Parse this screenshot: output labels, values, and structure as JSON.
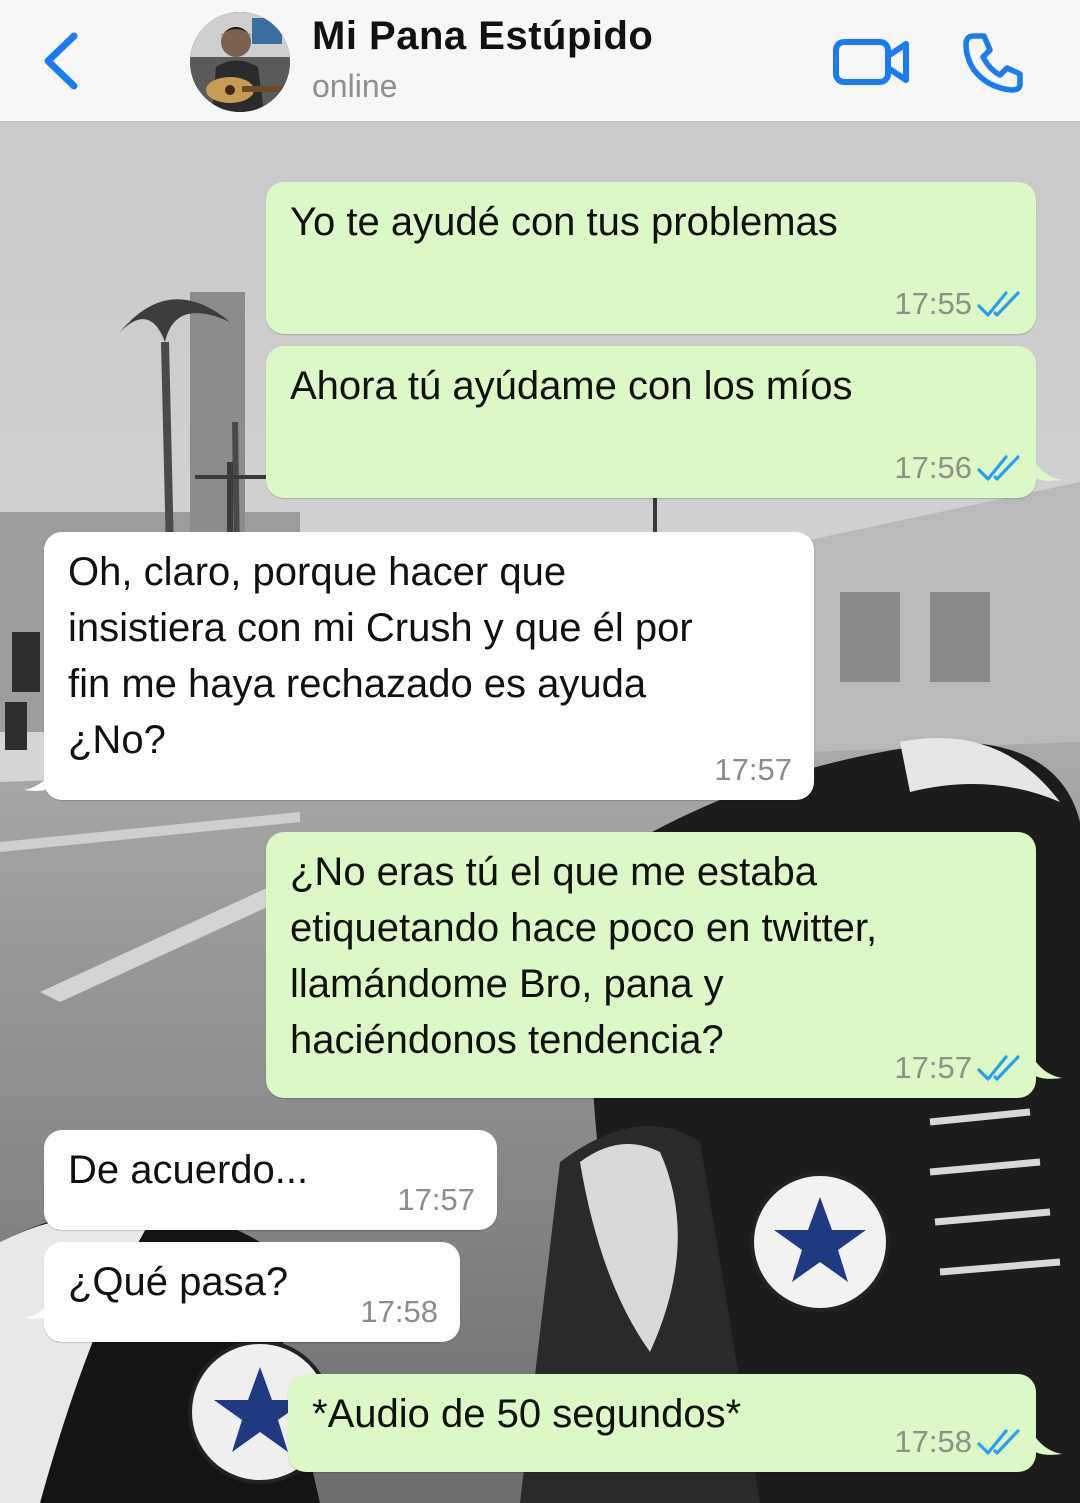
{
  "header": {
    "contact_name": "Mi Pana Estúpido",
    "status": "online",
    "back_icon": "chevron-left-icon",
    "video_icon": "video-camera-icon",
    "phone_icon": "phone-icon"
  },
  "colors": {
    "accent": "#1a7cf5",
    "outgoing_bubble": "#dcf8c6",
    "incoming_bubble": "#ffffff",
    "read_ticks": "#2aa0ec"
  },
  "messages": [
    {
      "direction": "outgoing",
      "text": "Yo te ayudé con tus problemas",
      "time": "17:55",
      "read": true
    },
    {
      "direction": "outgoing",
      "text": "Ahora tú ayúdame con los míos",
      "time": "17:56",
      "read": true
    },
    {
      "direction": "incoming",
      "lines": [
        "Oh, claro, porque hacer que",
        "insistiera con mi Crush y que él por",
        "fin me haya rechazado es ayuda",
        "¿No?"
      ],
      "time": "17:57"
    },
    {
      "direction": "outgoing",
      "lines": [
        "¿No eras tú el que me estaba",
        "etiquetando hace poco en twitter,",
        "llamándome Bro, pana y",
        "haciéndonos tendencia?"
      ],
      "time": "17:57",
      "read": true
    },
    {
      "direction": "incoming",
      "text": "De acuerdo...",
      "time": "17:57"
    },
    {
      "direction": "incoming",
      "text": "¿Qué pasa?",
      "time": "17:58"
    },
    {
      "direction": "outgoing",
      "text": "*Audio de 50 segundos*",
      "time": "17:58",
      "read": true
    }
  ]
}
